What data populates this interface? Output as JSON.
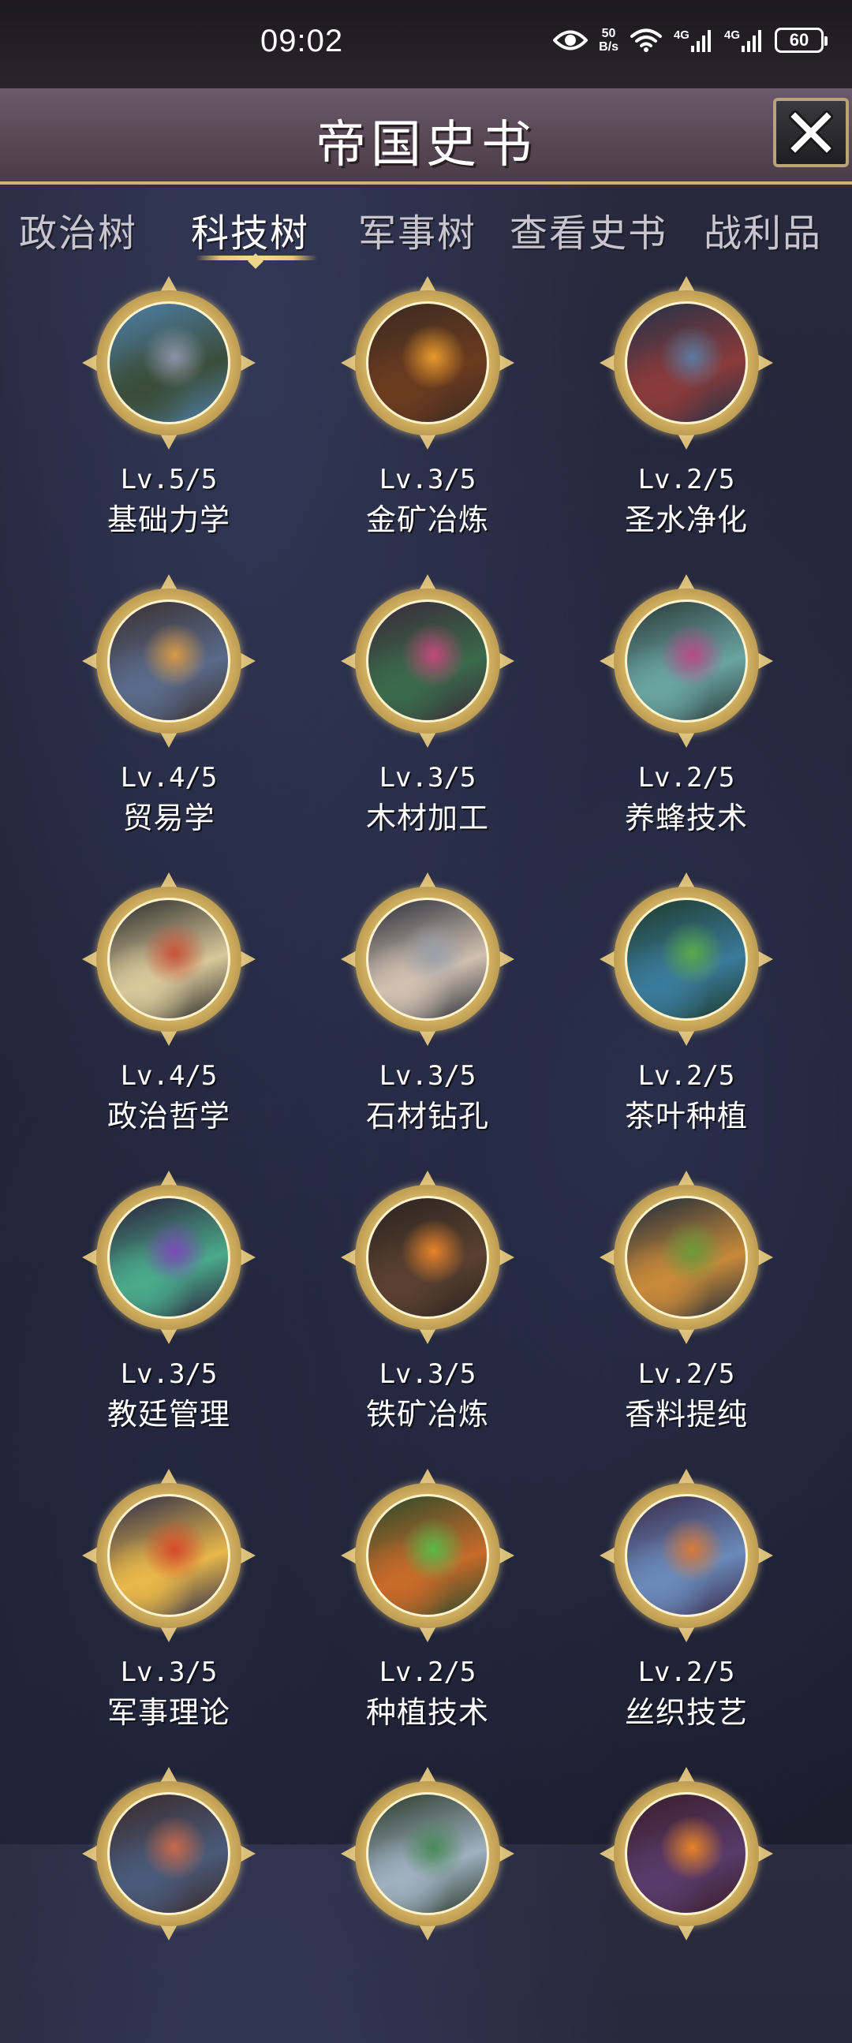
{
  "status_bar": {
    "time": "09:02",
    "speed_value": "50",
    "speed_unit": "B/s",
    "network_1": "4G",
    "network_2": "4G",
    "battery": "60"
  },
  "header": {
    "title": "帝国史书"
  },
  "tabs": [
    {
      "label": "政治树",
      "active": false
    },
    {
      "label": "科技树",
      "active": true
    },
    {
      "label": "军事树",
      "active": false
    },
    {
      "label": "查看史书",
      "active": false
    },
    {
      "label": "战利品",
      "active": false
    }
  ],
  "tech_items": [
    {
      "level": "Lv.5/5",
      "name": "基础力学",
      "icon": "statue-artwork",
      "colors": [
        "#4e7fa8",
        "#8b93a4",
        "#3b4d3a"
      ]
    },
    {
      "level": "Lv.3/5",
      "name": "金矿冶炼",
      "icon": "furnace-artwork",
      "colors": [
        "#3a2a22",
        "#e89a2c",
        "#6b3b1f"
      ]
    },
    {
      "level": "Lv.2/5",
      "name": "圣水净化",
      "icon": "fountain-artwork",
      "colors": [
        "#243248",
        "#5c7aa0",
        "#8a3a3a"
      ]
    },
    {
      "level": "Lv.4/5",
      "name": "贸易学",
      "icon": "market-artwork",
      "colors": [
        "#3a3030",
        "#d89a48",
        "#5a6a8a"
      ]
    },
    {
      "level": "Lv.3/5",
      "name": "木材加工",
      "icon": "forest-artwork",
      "colors": [
        "#3a2a3a",
        "#c24a7a",
        "#3a6a4a"
      ]
    },
    {
      "level": "Lv.2/5",
      "name": "养蜂技术",
      "icon": "beehive-artwork",
      "colors": [
        "#2a3a3a",
        "#b84a8a",
        "#6aa4a0"
      ]
    },
    {
      "level": "Lv.4/5",
      "name": "政治哲学",
      "icon": "philosopher-artwork",
      "colors": [
        "#2a2a2a",
        "#c9533a",
        "#d8c89a"
      ]
    },
    {
      "level": "Lv.3/5",
      "name": "石材钻孔",
      "icon": "drill-artwork",
      "colors": [
        "#2a2e3a",
        "#9aa0aa",
        "#d0c0b0"
      ]
    },
    {
      "level": "Lv.2/5",
      "name": "茶叶种植",
      "icon": "tea-tree-artwork",
      "colors": [
        "#1e3a2a",
        "#5aaa4a",
        "#3a7a9a"
      ]
    },
    {
      "level": "Lv.3/5",
      "name": "教廷管理",
      "icon": "church-artwork",
      "colors": [
        "#2a1e3a",
        "#7a4ab8",
        "#4aaa8a"
      ]
    },
    {
      "level": "Lv.3/5",
      "name": "铁矿冶炼",
      "icon": "forge-artwork",
      "colors": [
        "#2a2420",
        "#e8842a",
        "#5a4030"
      ]
    },
    {
      "level": "Lv.2/5",
      "name": "香料提纯",
      "icon": "spice-artwork",
      "colors": [
        "#1e2a3a",
        "#6a9a3a",
        "#c88a3a"
      ]
    },
    {
      "level": "Lv.3/5",
      "name": "军事理论",
      "icon": "knight-artwork",
      "colors": [
        "#2a2a4a",
        "#d84a2a",
        "#e8b84a"
      ]
    },
    {
      "level": "Lv.2/5",
      "name": "种植技术",
      "icon": "farm-artwork",
      "colors": [
        "#2a4a2a",
        "#5aba4a",
        "#c86a2a"
      ]
    },
    {
      "level": "Lv.2/5",
      "name": "丝织技艺",
      "icon": "village-artwork",
      "colors": [
        "#3a2a4a",
        "#d87a3a",
        "#6a8aba"
      ]
    },
    {
      "level": "",
      "name": "",
      "icon": "warrior-artwork",
      "colors": [
        "#3a2a2a",
        "#c86a4a",
        "#4a5a7a"
      ]
    },
    {
      "level": "",
      "name": "",
      "icon": "pavilion-artwork",
      "colors": [
        "#2a3a2a",
        "#4a8a5a",
        "#a0b0c0"
      ]
    },
    {
      "level": "",
      "name": "",
      "icon": "throne-artwork",
      "colors": [
        "#3a1e2a",
        "#e8842a",
        "#5a3a6a"
      ]
    }
  ]
}
